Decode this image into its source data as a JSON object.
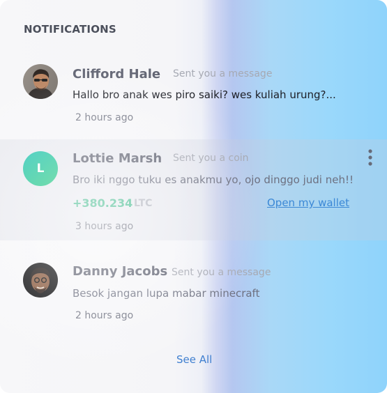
{
  "panel": {
    "title": "NOTIFICATIONS",
    "see_all_label": "See All"
  },
  "notifications": [
    {
      "name": "Clifford Hale",
      "action": "Sent you a message",
      "message": "Hallo bro anak wes piro saiki? wes kuliah urung?...",
      "time": "2 hours ago",
      "avatar": "photo-avatar"
    },
    {
      "name": "Lottie Marsh",
      "action": "Sent you a coin",
      "message": "Bro iki nggo tuku es anakmu yo, ojo dinggo judi neh!!",
      "time": "3 hours ago",
      "avatar_letter": "L",
      "amount": "+380.234",
      "currency": "LTC",
      "wallet_link": "Open my wallet",
      "highlighted": true
    },
    {
      "name": "Danny Jacobs",
      "action": "Sent you a message",
      "message": "Besok jangan lupa mabar minecraft",
      "time": "2 hours ago",
      "avatar": "photo-avatar"
    }
  ],
  "colors": {
    "accent_link": "#3b88d6",
    "coin_green": "#3cb88a",
    "avatar_gradient_start": "#23c4b6",
    "avatar_gradient_end": "#1ec77c"
  },
  "icons": [
    "more-vertical-icon"
  ]
}
